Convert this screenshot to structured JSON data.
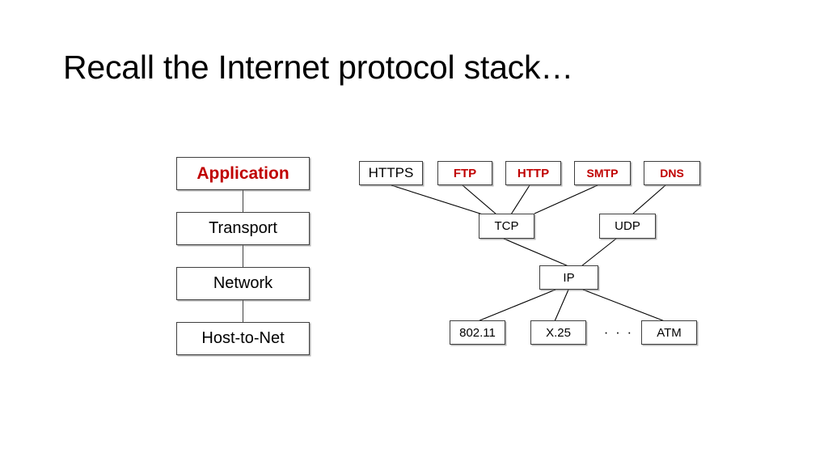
{
  "slide": {
    "title": "Recall the Internet protocol stack…",
    "background_color": "#FFFFFF",
    "accent_color": "#C00000",
    "text_color": "#000000"
  },
  "layer_stack": {
    "name": "internet-protocol-layer-stack",
    "boxes": [
      {
        "label": "Application",
        "highlight": true,
        "color": "#C00000"
      },
      {
        "label": "Transport",
        "highlight": false,
        "color": "#000000"
      },
      {
        "label": "Network",
        "highlight": false,
        "color": "#000000"
      },
      {
        "label": "Host-to-Net",
        "highlight": false,
        "color": "#000000"
      }
    ]
  },
  "protocol_tree": {
    "application_layer": [
      {
        "label": "HTTPS",
        "highlight": false,
        "color": "#000000",
        "parent": "TCP"
      },
      {
        "label": "FTP",
        "highlight": true,
        "color": "#C00000",
        "parent": "TCP"
      },
      {
        "label": "HTTP",
        "highlight": true,
        "color": "#C00000",
        "parent": "TCP"
      },
      {
        "label": "SMTP",
        "highlight": true,
        "color": "#C00000",
        "parent": "TCP"
      },
      {
        "label": "DNS",
        "highlight": true,
        "color": "#C00000",
        "parent": "UDP"
      }
    ],
    "transport_layer": [
      {
        "label": "TCP",
        "highlight": false,
        "color": "#000000",
        "parent": "IP"
      },
      {
        "label": "UDP",
        "highlight": false,
        "color": "#000000",
        "parent": "IP"
      }
    ],
    "network_layer": [
      {
        "label": "IP",
        "highlight": false,
        "color": "#000000"
      }
    ],
    "link_layer": [
      {
        "label": "802.11",
        "highlight": false,
        "color": "#000000",
        "parent": "IP",
        "boxed": true
      },
      {
        "label": "X.25",
        "highlight": false,
        "color": "#000000",
        "parent": "IP",
        "boxed": true
      },
      {
        "label": "· · ·",
        "highlight": false,
        "color": "#000000",
        "parent": null,
        "boxed": false
      },
      {
        "label": "ATM",
        "highlight": false,
        "color": "#000000",
        "parent": "IP",
        "boxed": true
      }
    ]
  }
}
